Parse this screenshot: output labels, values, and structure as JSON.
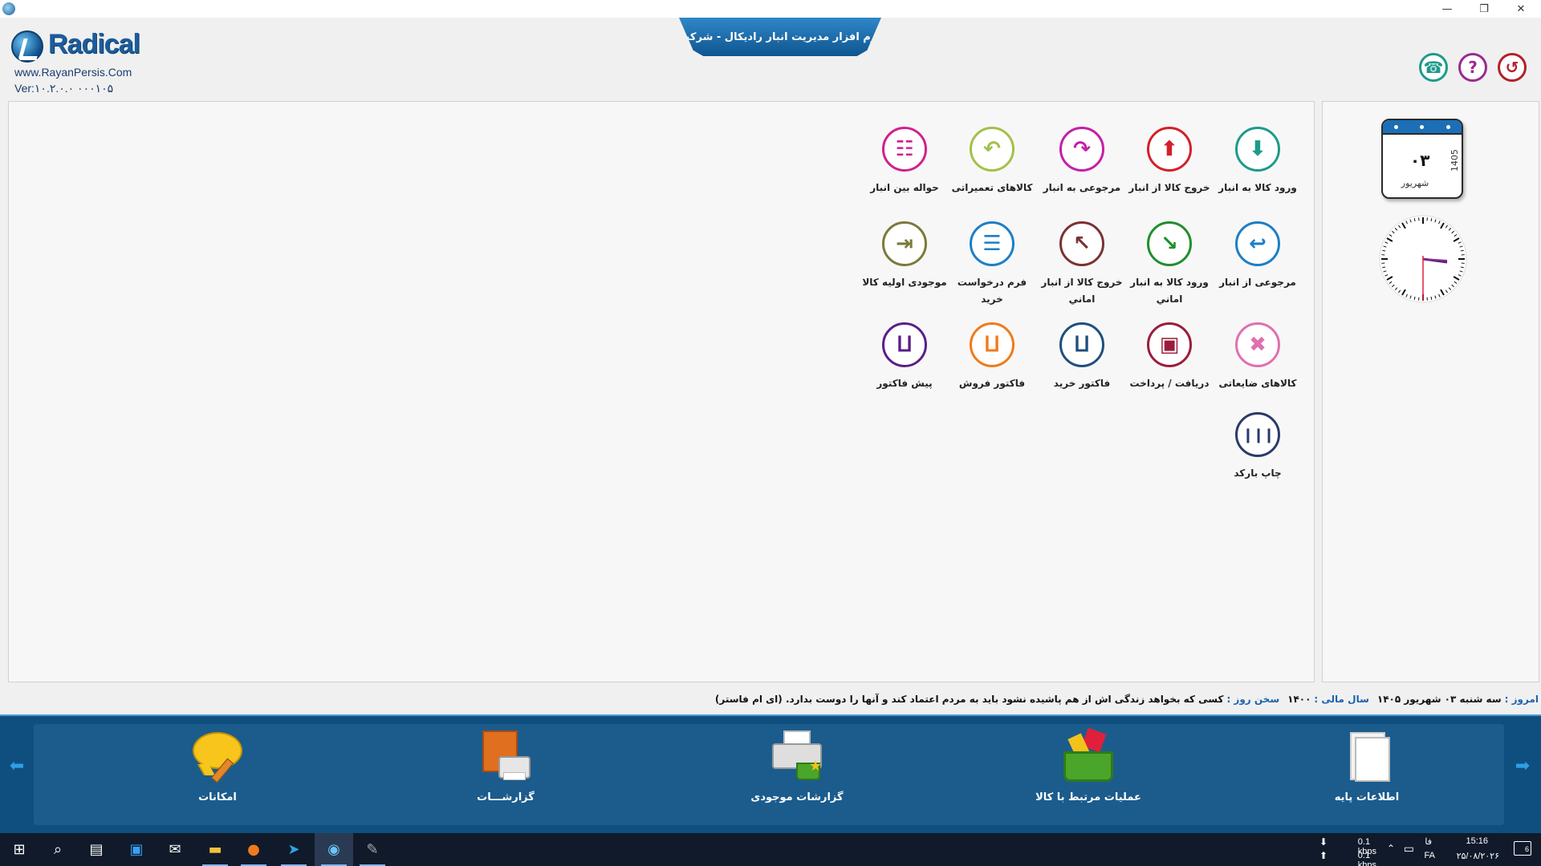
{
  "window": {
    "minimize": "—",
    "restore": "❐",
    "close": "✕"
  },
  "header": {
    "logo_text": "Radical",
    "website": "www.RayanPersis.Com",
    "version": "Ver:۱۰.۲.۰.۰ ۰۰۰۱۰۵",
    "title": "نرم افزار مدیریت انبار رادیکال - شرکت",
    "icons": {
      "phone": "phone-icon",
      "help": "help-icon",
      "exit": "power-icon"
    }
  },
  "menu": [
    {
      "label": "ورود کالا به انبار",
      "icon": "import-down-arrow-icon",
      "color": "#1e9a8a"
    },
    {
      "label": "خروج کالا از انبار",
      "icon": "export-up-arrow-icon",
      "color": "#d3202a"
    },
    {
      "label": "مرجوعی به انبار",
      "icon": "return-curved-arrow-icon",
      "color": "#c41fa8"
    },
    {
      "label": "کالاهای تعمیراتی",
      "icon": "undo-arrow-icon",
      "color": "#a3c04a"
    },
    {
      "label": "حواله بین انبار",
      "icon": "document-transfer-icon",
      "color": "#d0218b"
    },
    {
      "label": "مرجوعی از انبار",
      "icon": "return-arrow-icon",
      "color": "#1c7fc4"
    },
    {
      "label": "ورود کالا به انبار اماني",
      "icon": "diagonal-down-arrow-icon",
      "color": "#1f8f2e"
    },
    {
      "label": "خروج کالا از انبار اماني",
      "icon": "diagonal-up-arrow-icon",
      "color": "#7a3232"
    },
    {
      "label": "فرم درخواست خرید",
      "icon": "form-document-icon",
      "color": "#1c7fc4"
    },
    {
      "label": "موجودی اولیه کالا",
      "icon": "login-box-icon",
      "color": "#7a7a3a"
    },
    {
      "label": "کالاهای ضایعاتی",
      "icon": "damaged-item-icon",
      "color": "#e070b0"
    },
    {
      "label": "دریافت / پرداخت",
      "icon": "wallet-icon",
      "color": "#9b1c3a"
    },
    {
      "label": "فاکتور خرید",
      "icon": "basket-icon",
      "color": "#1e4f7f"
    },
    {
      "label": "فاکتور فروش",
      "icon": "basket-icon",
      "color": "#f07a1a"
    },
    {
      "label": "پیش فاکتور",
      "icon": "basket-icon",
      "color": "#5a1f86"
    },
    {
      "label": "چاپ بارکد",
      "icon": "barcode-icon",
      "color": "#2a3a6a"
    }
  ],
  "calendar": {
    "day": "۰۳",
    "month": "شهریور",
    "year": "1405"
  },
  "clock": {
    "time": "15:16"
  },
  "status": {
    "today_label": "امروز :",
    "today_value": "سه شنبه ۰۳ شهریور ۱۴۰۵",
    "fiscal_label": "سال مالی :",
    "fiscal_value": "۱۴۰۰",
    "quote_label": "سخن روز :",
    "quote_value": "کسی که بخواهد زندگی اش از هم پاشیده نشود باید به مردم اعتماد کند و آنها را دوست بدارد. (ای ام فاستر)"
  },
  "toolbar": [
    {
      "label": "اطلاعات پایه",
      "icon": "document-icon"
    },
    {
      "label": "عملیات مرتبط با کالا",
      "icon": "shopping-basket-icon"
    },
    {
      "label": "گزارشات موجودی",
      "icon": "printer-basket-icon"
    },
    {
      "label": "گزارشـــات",
      "icon": "printer-report-icon"
    },
    {
      "label": "امکانات",
      "icon": "speech-bubble-pencil-icon"
    }
  ],
  "taskbar": {
    "net_down": "0.1 kbps",
    "net_up": "0.1 kbps",
    "lang_top": "فا",
    "lang_bottom": "FA",
    "time": "15:16",
    "date": "۲۵/۰۸/۲۰۲۶",
    "notification_count": "6"
  }
}
